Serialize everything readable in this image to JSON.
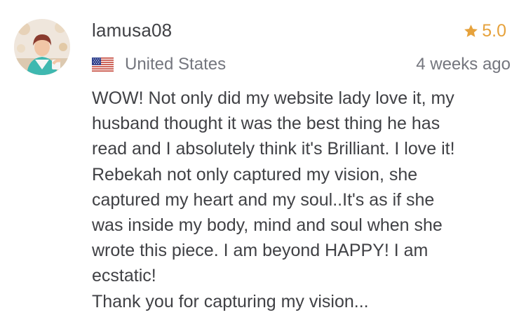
{
  "review": {
    "username": "lamusa08",
    "rating": "5.0",
    "country": "United States",
    "timestamp": "4 weeks ago",
    "lines": [
      "WOW! Not only did my website lady love it, my",
      "husband thought it was the best thing he has",
      "read and I absolutely think it's Brilliant. I love it!",
      "Rebekah not only captured my vision, she",
      "captured my heart and my soul..It's as if she",
      "was inside my body, mind and soul when she",
      "wrote this piece. I am beyond HAPPY! I am",
      "ecstatic!",
      "Thank you for capturing my vision..."
    ]
  },
  "icons": {
    "avatar": "user-avatar-photo",
    "flag": "us-flag-icon",
    "star": "star-icon"
  },
  "colors": {
    "text_primary": "#404145",
    "text_secondary": "#74767e",
    "star": "#e6a23c"
  }
}
